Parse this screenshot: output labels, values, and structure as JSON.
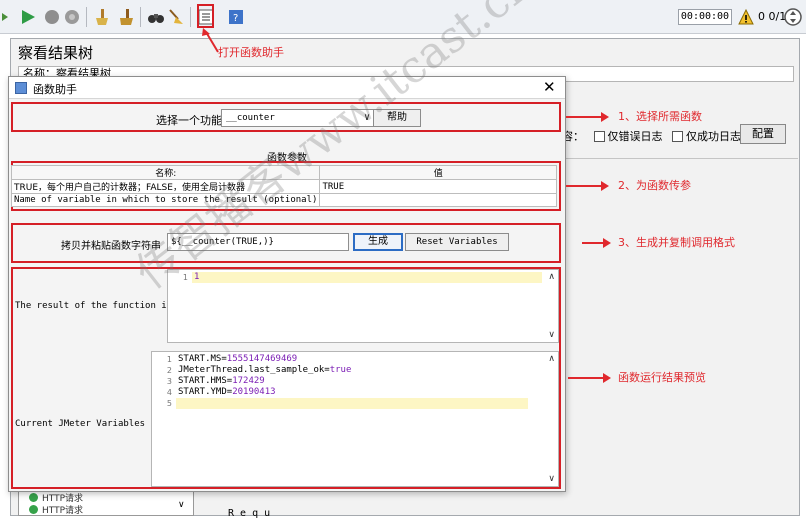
{
  "toolbar": {
    "timer": "00:00:00",
    "warn_count": "0 0/1"
  },
  "background": {
    "panel_title": "察看结果树",
    "name_label": "名称：",
    "name_value": "察看结果树",
    "right_options_prefix": "容：",
    "errors_only_label": "仅错误日志",
    "success_only_label": "仅成功日志",
    "config_button": "配置",
    "tree_items": [
      "HTTP请求",
      "HTTP请求"
    ],
    "bottom_text": "R e q u"
  },
  "dialog": {
    "title": "函数助手",
    "close_symbol": "✕",
    "select_label": "选择一个功能",
    "select_value": "__counter",
    "help_button": "帮助",
    "params_caption": "函数参数",
    "params_headers": [
      "名称:",
      "值"
    ],
    "params_rows": [
      {
        "name": "TRUE，每个用户自己的计数器；FALSE，使用全局计数器",
        "value": "TRUE"
      },
      {
        "name": "Name of variable in which to store the result (optional)",
        "value": ""
      }
    ],
    "gen_label": "拷贝并粘贴函数字符串",
    "gen_value": "${__counter(TRUE,)}",
    "generate_button": "生成",
    "reset_button": "Reset Variables",
    "result_label": "The result of the function is",
    "result_lines": [
      "1"
    ],
    "vars_label": "Current JMeter Variables",
    "vars_lines": [
      {
        "key": "START.MS=",
        "val": "1555147469469"
      },
      {
        "key": "JMeterThread.last_sample_ok=",
        "val": "true"
      },
      {
        "key": "START.HMS=",
        "val": "172429"
      },
      {
        "key": "START.YMD=",
        "val": "20190413"
      },
      {
        "key": "",
        "val": ""
      }
    ]
  },
  "annotations": {
    "open_helper": "打开函数助手",
    "step1": "1、选择所需函数",
    "step2": "2、为函数传参",
    "step3": "3、生成并复制调用格式",
    "preview": "函数运行结果预览"
  },
  "colors": {
    "annotation_red": "#e0282d",
    "value_purple": "#7c1fb5",
    "highlight_line": "#fdf6c4"
  },
  "watermark": {
    "text": "传智播客www.itcast.cn"
  }
}
